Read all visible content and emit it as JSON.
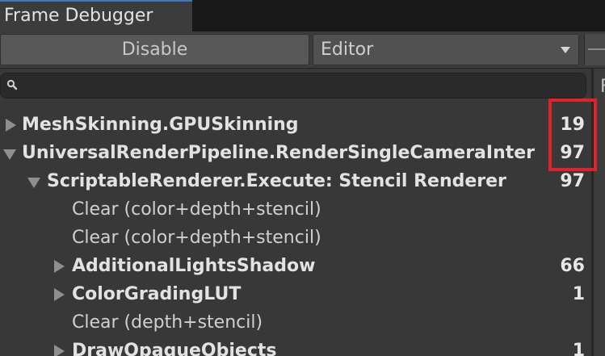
{
  "window": {
    "tab_title": "Frame Debugger"
  },
  "toolbar": {
    "disable_label": "Disable",
    "target_dropdown": {
      "selected": "Editor"
    }
  },
  "search": {
    "value": "",
    "placeholder": ""
  },
  "right_panel": {
    "partial_text": "F"
  },
  "tree": {
    "rows": [
      {
        "label": "MeshSkinning.GPUSkinning",
        "count": "19",
        "expanded": false,
        "bold": true,
        "depth": 0
      },
      {
        "label": "UniversalRenderPipeline.RenderSingleCameraInter",
        "count": "97",
        "expanded": true,
        "bold": true,
        "depth": 0
      },
      {
        "label": "ScriptableRenderer.Execute: Stencil Renderer",
        "count": "97",
        "expanded": true,
        "bold": true,
        "depth": 1
      },
      {
        "label": "Clear (color+depth+stencil)",
        "count": "",
        "bold": false,
        "depth": 2
      },
      {
        "label": "Clear (color+depth+stencil)",
        "count": "",
        "bold": false,
        "depth": 2
      },
      {
        "label": "AdditionalLightsShadow",
        "count": "66",
        "expanded": false,
        "bold": true,
        "depth": 2
      },
      {
        "label": "ColorGradingLUT",
        "count": "1",
        "expanded": false,
        "bold": true,
        "depth": 2
      },
      {
        "label": "Clear (depth+stencil)",
        "count": "",
        "bold": false,
        "depth": 2
      },
      {
        "label": "DrawOpaqueObjects",
        "count": "1",
        "expanded": false,
        "bold": true,
        "depth": 2
      }
    ]
  },
  "colors": {
    "highlight": "#e0232a",
    "background": "#383838",
    "tab_accent": "#3a79bb"
  }
}
